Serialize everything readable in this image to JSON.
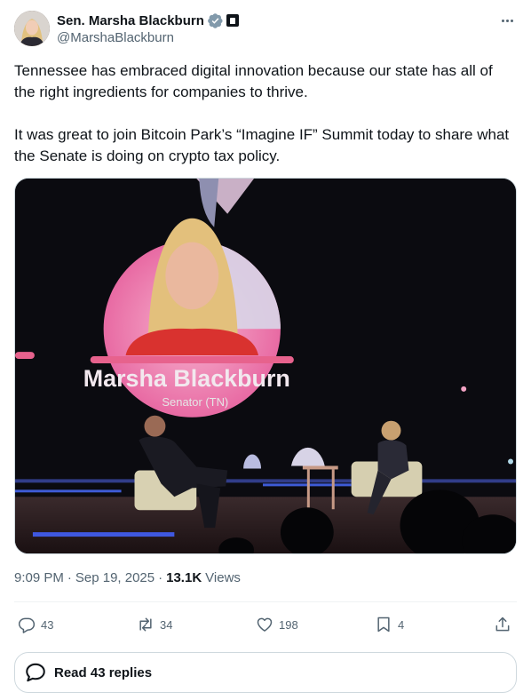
{
  "author": {
    "display_name": "Sen. Marsha Blackburn",
    "handle": "@MarshaBlackburn"
  },
  "tweet": {
    "text": "Tennessee has embraced digital innovation because our state has all of the right ingredients for companies to thrive.\n\nIt was great to join Bitcoin Park’s “Imagine IF” Summit today to share what the Senate is doing on crypto tax policy."
  },
  "media": {
    "screen_name": "Marsha Blackburn",
    "screen_title": "Senator (TN)"
  },
  "meta": {
    "time": "9:09 PM",
    "separator": "·",
    "date": "Sep 19, 2025",
    "views_count": "13.1K",
    "views_label": "Views"
  },
  "actions": {
    "replies": "43",
    "reposts": "34",
    "likes": "198",
    "bookmarks": "4"
  },
  "read_replies": {
    "label": "Read 43 replies"
  },
  "icons": [
    "verified-badge-icon",
    "government-badge-icon",
    "more-icon",
    "reply-icon",
    "repost-icon",
    "like-icon",
    "bookmark-icon",
    "share-icon",
    "speech-bubble-icon"
  ],
  "colors": {
    "text_primary": "#0f1419",
    "text_secondary": "#536471",
    "verified_gray": "#829aab",
    "border": "#cfd9de",
    "divider": "#eff3f4"
  }
}
